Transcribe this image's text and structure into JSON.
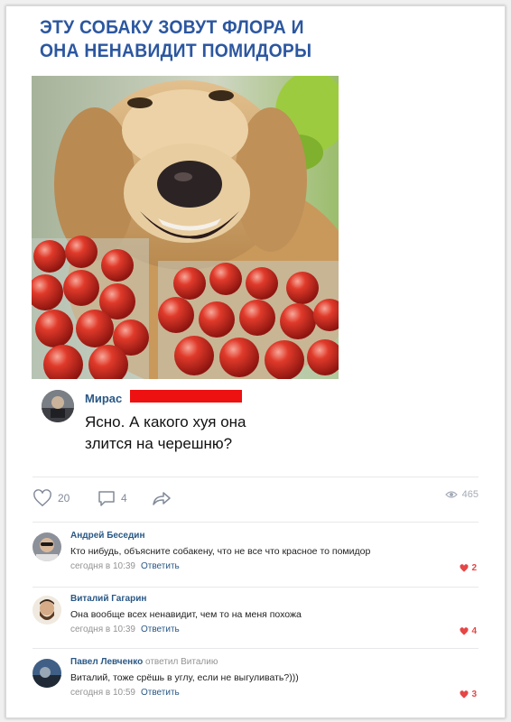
{
  "post": {
    "title": "ЭТУ СОБАКУ ЗОВУТ ФЛОРА И\nОНА НЕНАВИДИТ ПОМИДОРЫ"
  },
  "quote": {
    "author": "Мирас",
    "text": "Ясно. А какого хуя она\nзлится на черешню?"
  },
  "actions": {
    "likes": "20",
    "comments": "4",
    "views": "465"
  },
  "comments": [
    {
      "author": "Андрей Беседин",
      "reply_to": "",
      "text": "Кто нибудь, объясните собакену, что не все что красное то помидор",
      "time": "сегодня в 10:39",
      "answer": "Ответить",
      "likes": "2"
    },
    {
      "author": "Виталий Гагарин",
      "reply_to": "",
      "text": "Она вообще всех ненавидит, чем то на меня похожа",
      "time": "сегодня в 10:39",
      "answer": "Ответить",
      "likes": "4"
    },
    {
      "author": "Павел Левченко",
      "reply_to": "ответил Виталию",
      "text": "Виталий, тоже срёшь в углу, если не выгуливать?)))",
      "time": "сегодня в 10:59",
      "answer": "Ответить",
      "likes": "3"
    }
  ],
  "colors": {
    "title": "#2c57a0",
    "link": "#2a5885",
    "like": "#e64646",
    "muted": "#828a99"
  }
}
